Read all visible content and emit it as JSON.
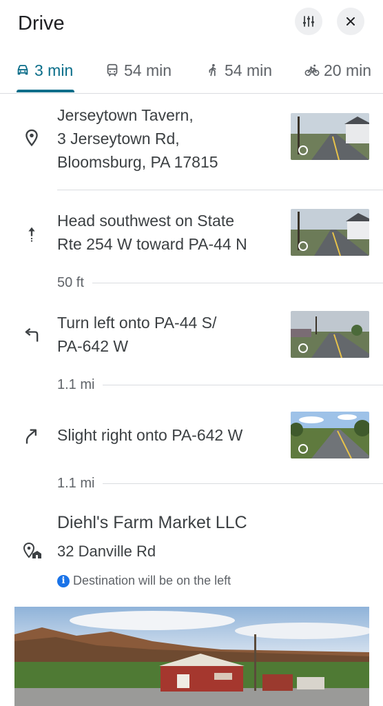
{
  "header": {
    "title": "Drive",
    "filter_icon": "tune-icon",
    "close_icon": "close-icon"
  },
  "tabs": [
    {
      "label": "3 min",
      "icon": "car-icon",
      "active": true
    },
    {
      "label": "54 min",
      "icon": "transit-icon",
      "active": false
    },
    {
      "label": "54 min",
      "icon": "walk-icon",
      "active": false
    },
    {
      "label": "20 min",
      "icon": "bike-icon",
      "active": false
    }
  ],
  "origin": {
    "icon": "place-pin-icon",
    "line1": "Jerseytown Tavern,",
    "line2": "3 Jerseytown Rd,",
    "line3": "Bloomsburg, PA 17815"
  },
  "steps": [
    {
      "icon": "straight-arrow-icon",
      "line1": "Head southwest on State",
      "line2": "Rte 254 W toward PA-44 N",
      "distance": "50 ft"
    },
    {
      "icon": "turn-left-icon",
      "line1": "Turn left onto PA-44 S/",
      "line2": "PA-642 W",
      "distance": "1.1 mi"
    },
    {
      "icon": "slight-right-icon",
      "line1": "Slight right onto PA-642 W",
      "line2": "",
      "distance": "1.1 mi"
    }
  ],
  "destination": {
    "icon": "destination-flag-icon",
    "name": "Diehl's Farm Market LLC",
    "address": "32 Danville Rd",
    "note": "Destination will be on the left",
    "note_icon": "info-icon"
  },
  "colors": {
    "accent": "#0b6e8a",
    "info": "#1a73e8",
    "text": "#3c4043",
    "secondary": "#5f6368",
    "divider": "#dadce0"
  }
}
